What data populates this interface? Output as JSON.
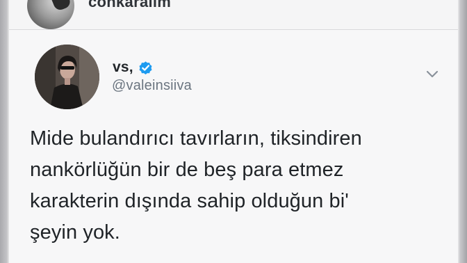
{
  "previous_tweet": {
    "name": "conkaralım"
  },
  "tweet": {
    "display_name": "vs,",
    "handle": "@valeinsiiva",
    "verified": true,
    "text_lines": [
      "Mide bulandırıcı tavırların, tiksindiren",
      "nankörlüğün bir de beş para etmez",
      "karakterin dışında sahip olduğun bi'",
      "şeyin yok."
    ]
  },
  "icons": {
    "verified": "verified-badge-icon",
    "more": "chevron-down-icon"
  },
  "colors": {
    "verified_blue": "#1d9bf0",
    "text": "#1f2327",
    "handle": "#6b7580"
  }
}
